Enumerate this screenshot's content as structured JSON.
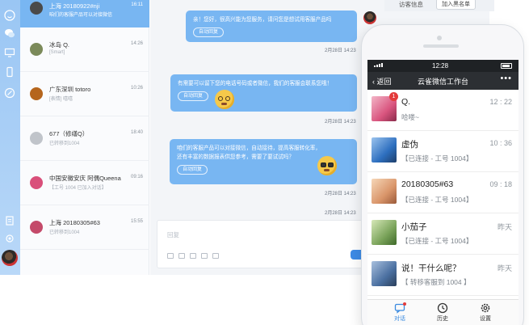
{
  "desktop": {
    "conversations": [
      {
        "name": "上海 20180922#nji",
        "subtitle": "咱们的客服产品可以对接微信",
        "time": "16:11",
        "active": true,
        "avatar_color": "#4a4a4a"
      },
      {
        "name": "冰岛 Q.",
        "subtitle": "[Smart]",
        "time": "14:26",
        "active": false,
        "avatar_color": "#7b8a5a"
      },
      {
        "name": "广东深圳 totoro",
        "subtitle": "[表情] 嘻嘻",
        "time": "10:26",
        "active": false,
        "avatar_color": "#b5651d"
      },
      {
        "name": "677（修缮Q）",
        "subtitle": "已转移到1004",
        "time": "18:40",
        "active": false,
        "avatar_color": "#c0c4ca"
      },
      {
        "name": "中国安徽安庆 阿偶Queena",
        "subtitle": "【工号 1004 已加入对话】",
        "time": "09:16",
        "active": false,
        "avatar_color": "#d94f7a"
      },
      {
        "name": "上海 20180305#63",
        "subtitle": "已转移到1004",
        "time": "15:55",
        "active": false,
        "avatar_color": "#c44a6a"
      }
    ],
    "messages": [
      {
        "text": "亲！您好，很高兴能为您服务，请问您是想试用客服产品吗",
        "tag": "自动回复",
        "time": "2月28日 14:23",
        "emoji": ""
      },
      {
        "text": "有需要可以留下您的电话号码或者微信，我们的客服会联系您哦！",
        "tag": "自动回复",
        "time": "2月28日 14:23",
        "emoji": "smile"
      },
      {
        "text": "咱们的客服产品可以对接微信，自动接待，提高客服转化率，还有丰富的数据报表供您参考，需要了要试试吗？",
        "tag": "自动回复",
        "time": "2月28日 14:23",
        "emoji": "glasses"
      }
    ],
    "composer_placeholder": "回复",
    "visitor_info": "访客信息",
    "add_blacklist": "加入黑名单",
    "last_time": "2月28日 14:23"
  },
  "phone": {
    "status_time": "12:28",
    "back_label": "返回",
    "title": "云雀微信工作台",
    "more": "•••",
    "chats": [
      {
        "name": "Q.",
        "status": "哈喽~",
        "time": "12 : 22",
        "badge": "1",
        "avatar_color": "#d9557f"
      },
      {
        "name": "虚伪",
        "status": "【已连接 - 工号 1004】",
        "time": "10 : 36",
        "badge": "",
        "avatar_color": "#2d6fbf"
      },
      {
        "name": "20180305#63",
        "status": "【已连接 - 工号 1004】",
        "time": "09 : 18",
        "badge": "",
        "avatar_color": "#d9956a"
      },
      {
        "name": "小茄子",
        "status": "【已连接 - 工号 1004】",
        "time": "昨天",
        "badge": "",
        "avatar_color": "#7aa35a"
      },
      {
        "name": "说！干什么呢？",
        "status": "【 转移客服到 1004 】",
        "time": "昨天",
        "badge": "",
        "avatar_color": "#4a6fa0"
      }
    ],
    "tabs": [
      {
        "label": "对话",
        "icon": "chat-icon"
      },
      {
        "label": "历史",
        "icon": "history-icon"
      },
      {
        "label": "设置",
        "icon": "settings-icon"
      }
    ]
  },
  "colors": {
    "accent": "#78b6f2",
    "rail": "#9ac6f4",
    "nav": "#2c2f33",
    "tab_active": "#3b8be0"
  }
}
